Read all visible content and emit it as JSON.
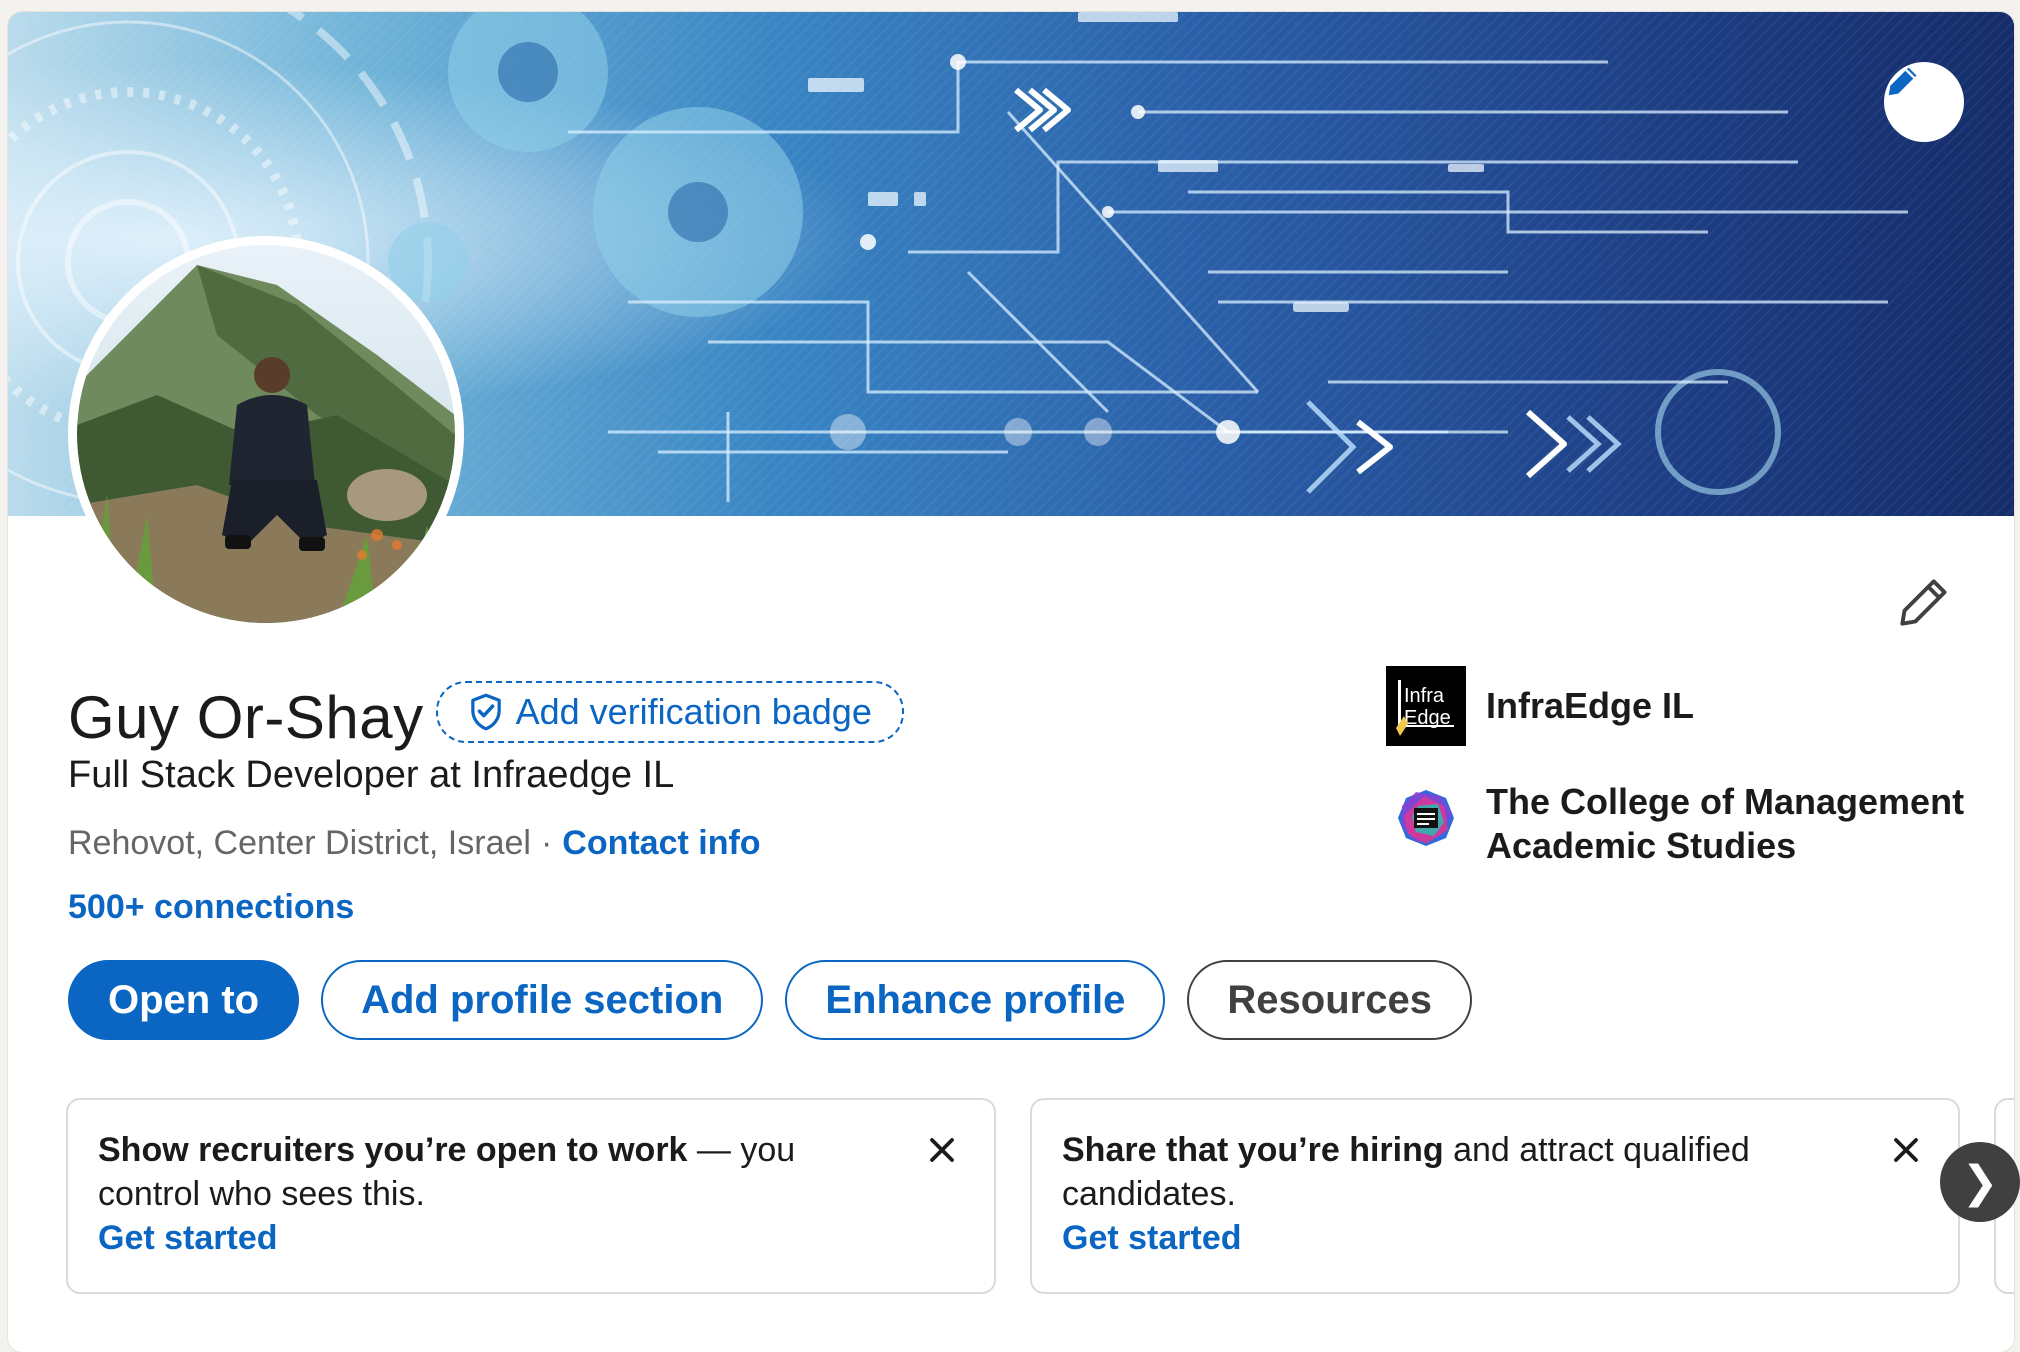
{
  "profile": {
    "name": "Guy Or-Shay",
    "verification_label": "Add verification badge",
    "headline": "Full Stack Developer at Infraedge IL",
    "location": "Rehovot, Center District, Israel",
    "separator": "·",
    "contact_info_label": "Contact info",
    "connections_label": "500+ connections"
  },
  "organizations": [
    {
      "name": "InfraEdge IL",
      "logo_icon": "infraedge-logo",
      "logo_text_top": "Infra",
      "logo_text_bottom": "Edge"
    },
    {
      "name": "The College of Management Academic Studies",
      "logo_icon": "college-logo"
    }
  ],
  "actions": {
    "open_to": "Open to",
    "add_profile_section": "Add profile section",
    "enhance_profile": "Enhance profile",
    "resources": "Resources"
  },
  "suggestions": [
    {
      "bold": "Show recruiters you’re open to work",
      "rest": " — you control who sees this.",
      "link": "Get started"
    },
    {
      "bold": "Share that you’re hiring",
      "rest": " and attract qualified candidates.",
      "link": "Get started"
    }
  ],
  "carousel": {
    "next_glyph": "❯"
  },
  "colors": {
    "brand_blue": "#0a66c2",
    "text_primary": "#1b1b1b",
    "text_secondary": "#666666",
    "neutral_button": "#404040"
  },
  "icons": {
    "banner_edit": "pencil-icon",
    "profile_edit": "pencil-outline-icon",
    "verification": "shield-check-icon",
    "dismiss": "close-icon",
    "carousel_next": "chevron-right-icon"
  }
}
